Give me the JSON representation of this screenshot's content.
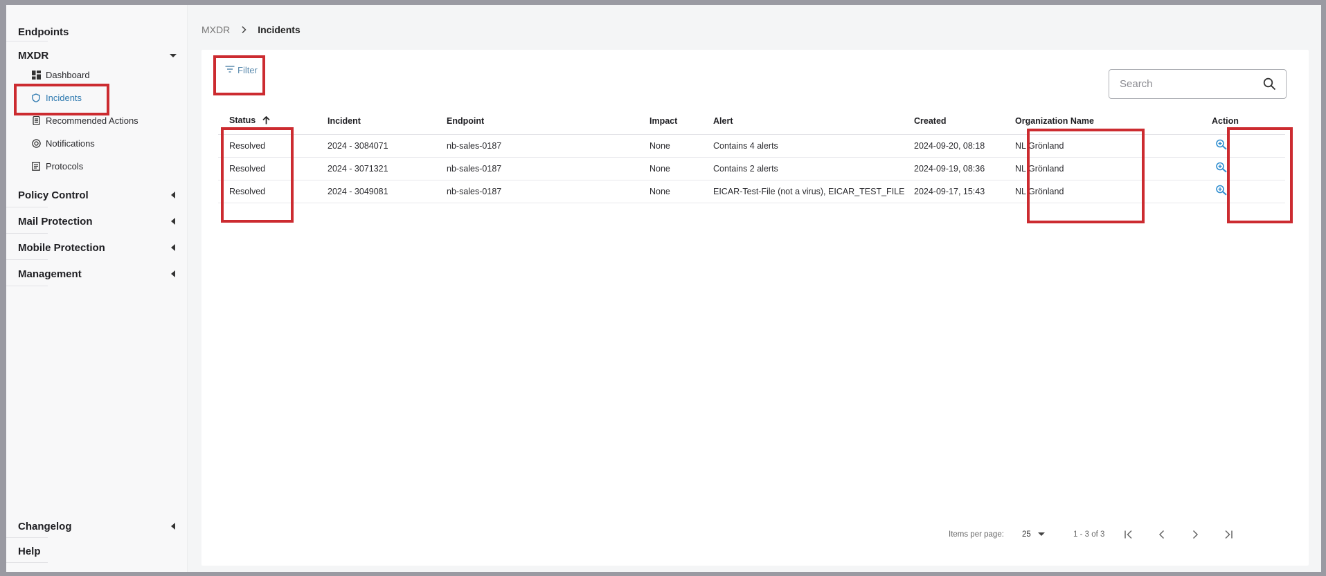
{
  "sidebar": {
    "top_sections": [
      {
        "label": "Endpoints"
      },
      {
        "label": "MXDR"
      }
    ],
    "mxdr_items": [
      {
        "label": "Dashboard",
        "icon": "dashboard-icon"
      },
      {
        "label": "Incidents",
        "icon": "shield-icon"
      },
      {
        "label": "Recommended Actions",
        "icon": "list-icon"
      },
      {
        "label": "Notifications",
        "icon": "notification-icon"
      },
      {
        "label": "Protocols",
        "icon": "document-icon"
      }
    ],
    "sections": [
      {
        "label": "Policy Control"
      },
      {
        "label": "Mail Protection"
      },
      {
        "label": "Mobile Protection"
      },
      {
        "label": "Management"
      }
    ],
    "bottom_sections": [
      {
        "label": "Changelog"
      },
      {
        "label": "Help"
      }
    ]
  },
  "breadcrumb": {
    "root": "MXDR",
    "current": "Incidents"
  },
  "toolbar": {
    "filter_label": "Filter",
    "search_placeholder": "Search"
  },
  "table": {
    "columns": {
      "status": "Status",
      "incident": "Incident",
      "endpoint": "Endpoint",
      "impact": "Impact",
      "alert": "Alert",
      "created": "Created",
      "organization": "Organization Name",
      "action": "Action"
    },
    "rows": [
      {
        "status": "Resolved",
        "incident": "2024 - 3084071",
        "endpoint": "nb-sales-0187",
        "impact": "None",
        "alert": "Contains 4 alerts",
        "created": "2024-09-20, 08:18",
        "organization": "NL Grönland"
      },
      {
        "status": "Resolved",
        "incident": "2024 - 3071321",
        "endpoint": "nb-sales-0187",
        "impact": "None",
        "alert": "Contains 2 alerts",
        "created": "2024-09-19, 08:36",
        "organization": "NL Grönland"
      },
      {
        "status": "Resolved",
        "incident": "2024 - 3049081",
        "endpoint": "nb-sales-0187",
        "impact": "None",
        "alert": "EICAR-Test-File (not a virus), EICAR_TEST_FILE",
        "created": "2024-09-17, 15:43",
        "organization": "NL Grönland"
      }
    ]
  },
  "paginator": {
    "items_per_page_label": "Items per page:",
    "items_per_page_value": "25",
    "range_label": "1 - 3 of 3"
  },
  "colors": {
    "accent": "#2f7ab0",
    "highlight": "#cc2b30",
    "action_icon": "#2f8ed0"
  }
}
